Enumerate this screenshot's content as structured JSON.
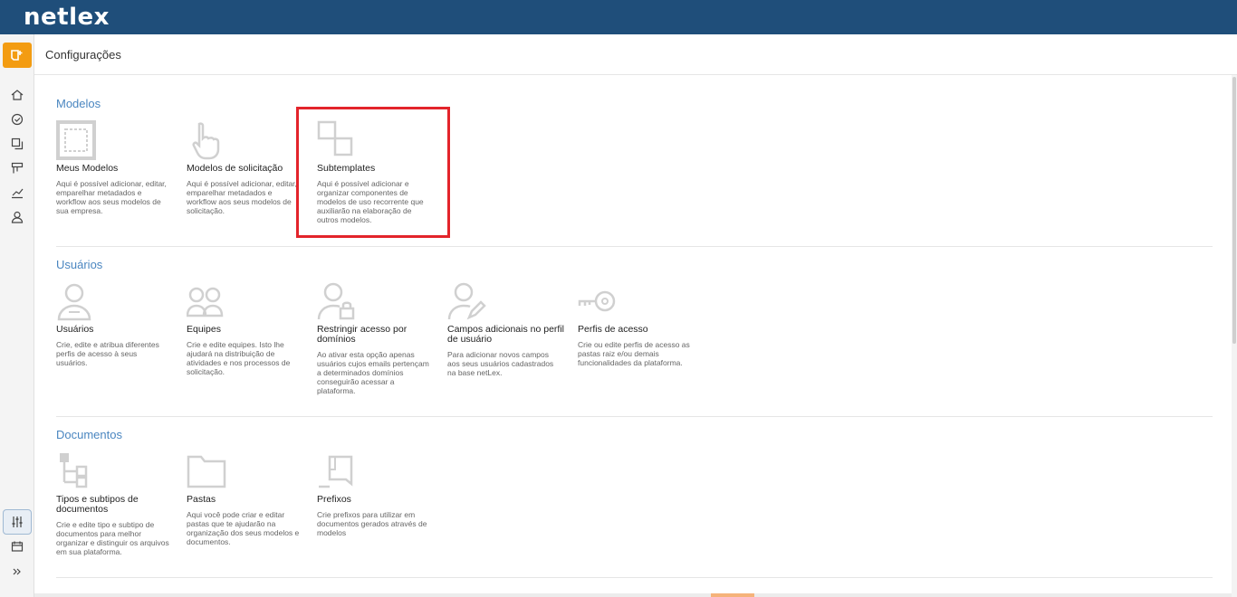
{
  "brand": {
    "logo_text": "netlex",
    "topbar_color": "#1f4e7a",
    "accent_color": "#f39c12"
  },
  "sidebar": {
    "items": [
      {
        "icon": "home-icon"
      },
      {
        "icon": "check-circle-icon"
      },
      {
        "icon": "copy-icon"
      },
      {
        "icon": "board-icon"
      },
      {
        "icon": "chart-icon"
      },
      {
        "icon": "user-icon"
      }
    ],
    "bottom": [
      {
        "icon": "sliders-icon",
        "active": true
      },
      {
        "icon": "calendar-icon"
      },
      {
        "icon": "expand-icon"
      }
    ]
  },
  "header": {
    "title": "Configurações"
  },
  "sections": [
    {
      "title": "Modelos",
      "items": [
        {
          "name": "Meus Modelos",
          "desc": "Aqui é possível adicionar, editar, emparelhar metadados e workflow aos seus modelos de sua empresa.",
          "icon": "template-icon"
        },
        {
          "name": "Modelos de solicitação",
          "desc": "Aqui é possível adicionar, editar, emparelhar metadados e workflow aos seus modelos de solicitação.",
          "icon": "hand-pointer-icon"
        },
        {
          "name": "Subtemplates",
          "desc": "Aqui é possível adicionar e organizar componentes de modelos de uso recorrente que auxiliarão na elaboração de outros modelos.",
          "icon": "subtemplate-icon",
          "highlighted": true
        }
      ]
    },
    {
      "title": "Usuários",
      "items": [
        {
          "name": "Usuários",
          "desc": "Crie, edite e atribua diferentes perfis de acesso à seus usuários.",
          "icon": "user-icon"
        },
        {
          "name": "Equipes",
          "desc": "Crie e edite equipes. Isto lhe ajudará na distribuição de atividades e nos processos de solicitação.",
          "icon": "team-icon"
        },
        {
          "name": "Restringir acesso por domínios",
          "desc": "Ao ativar esta opção apenas usuários cujos emails pertençam a determinados domínios conseguirão acessar a plataforma.",
          "icon": "user-lock-icon"
        },
        {
          "name": "Campos adicionais no perfil de usuário",
          "desc": "Para adicionar novos campos aos seus usuários cadastrados na base netLex.",
          "icon": "user-edit-icon"
        },
        {
          "name": "Perfis de acesso",
          "desc": "Crie ou edite perfis de acesso as pastas raiz e/ou demais funcionalidades da plataforma.",
          "icon": "key-icon"
        }
      ]
    },
    {
      "title": "Documentos",
      "items": [
        {
          "name": "Tipos e subtipos de documentos",
          "desc": "Crie e edite tipo e subtipo de documentos para melhor organizar e distinguir os arquivos em sua plataforma.",
          "icon": "tree-icon"
        },
        {
          "name": "Pastas",
          "desc": "Aqui você pode criar e editar pastas que te ajudarão na organização dos seus modelos e documentos.",
          "icon": "folder-icon"
        },
        {
          "name": "Prefixos",
          "desc": "Crie prefixos para utilizar em documentos gerados através de modelos",
          "icon": "prefix-icon"
        }
      ]
    }
  ]
}
